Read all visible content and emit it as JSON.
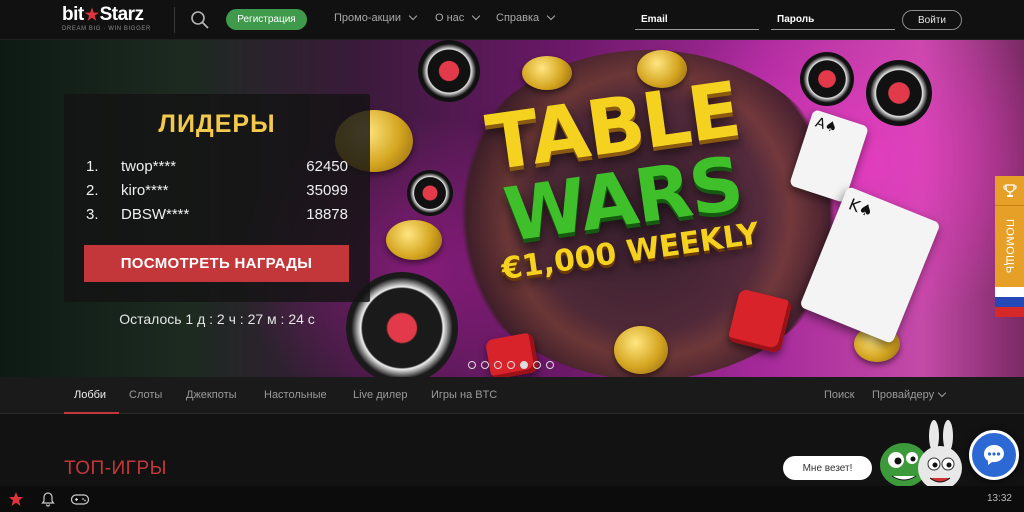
{
  "header": {
    "logo_main_left": "bit",
    "logo_main_right": "Starz",
    "logo_tagline": "DREAM BIG · WIN BIGGER",
    "register_label": "Регистрация",
    "nav": [
      "Промо-акции",
      "О нас",
      "Справка"
    ],
    "email_placeholder": "Email",
    "password_placeholder": "Пароль",
    "login_label": "Войти"
  },
  "banner": {
    "promo_line1": "TABLE",
    "promo_line2": "WARS",
    "promo_line3": "€1,000 WEEKLY",
    "leaders_title": "ЛИДЕРЫ",
    "leaders": [
      {
        "rank": "1.",
        "name": "twop****",
        "score": "62450"
      },
      {
        "rank": "2.",
        "name": "kiro****",
        "score": "35099"
      },
      {
        "rank": "3.",
        "name": "DBSW****",
        "score": "18878"
      }
    ],
    "rewards_button": "ПОСМОТРЕТЬ НАГРАДЫ",
    "countdown": "Осталось 1 д : 2 ч : 27 м : 24 с",
    "slides_total": 7,
    "active_slide": 5
  },
  "side_tab": {
    "help_label": "ПОМОЩЬ",
    "icons": [
      "trophy-icon",
      "russian-flag-icon"
    ]
  },
  "tabs": {
    "items": [
      "Лобби",
      "Слоты",
      "Джекпоты",
      "Настольные",
      "Live дилер",
      "Игры на BTC"
    ],
    "active": "Лобби",
    "search_label": "Поиск",
    "provider_label": "Провайдеру"
  },
  "main": {
    "section_title": "ТОП-ИГРЫ"
  },
  "chat": {
    "bubble_text": "Мне везет!"
  },
  "bottom_bar": {
    "icons": [
      "star-icon",
      "bell-icon",
      "gamepad-icon"
    ],
    "clock": "13:32"
  },
  "colors": {
    "accent_red": "#c3373a",
    "register_green": "#3f9a4b",
    "leaders_gold": "#f2c94c",
    "side_tab_orange": "#e6a028",
    "chat_blue": "#2d69d4"
  }
}
